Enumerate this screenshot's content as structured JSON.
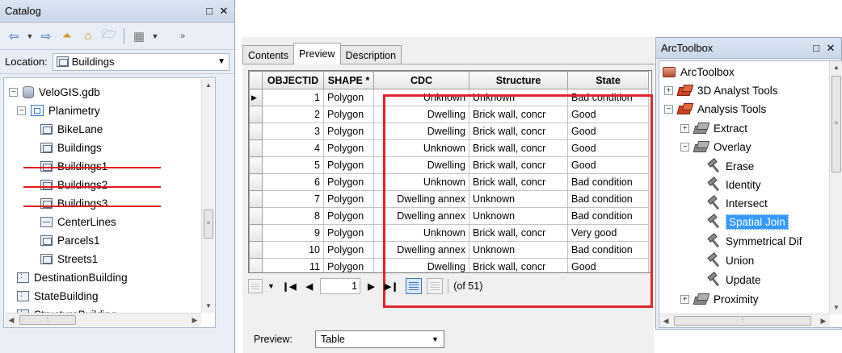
{
  "catalog": {
    "title": "Catalog",
    "location_label": "Location:",
    "location_value": "Buildings",
    "tree": [
      {
        "label": "VeloGIS.gdb",
        "icon": "geodatabase-icon",
        "expander": "−"
      },
      {
        "label": "Planimetry",
        "icon": "feature-dataset-icon",
        "expander": "−"
      },
      {
        "label": "BikeLane",
        "icon": "feature-class-icon"
      },
      {
        "label": "Buildings",
        "icon": "feature-class-icon"
      },
      {
        "label": "Buildings1",
        "icon": "feature-class-icon",
        "struck": true
      },
      {
        "label": "Buildings2",
        "icon": "feature-class-icon",
        "struck": true
      },
      {
        "label": "Buildings3",
        "icon": "feature-class-icon",
        "struck": true
      },
      {
        "label": "CenterLines",
        "icon": "line-feature-class-icon"
      },
      {
        "label": "Parcels1",
        "icon": "feature-class-icon"
      },
      {
        "label": "Streets1",
        "icon": "feature-class-icon"
      },
      {
        "label": "DestinationBuilding",
        "icon": "table-icon"
      },
      {
        "label": "StateBuilding",
        "icon": "table-icon"
      },
      {
        "label": "StructureBuilding",
        "icon": "table-icon"
      }
    ],
    "strike_color": "#e3191f"
  },
  "table_window": {
    "tabs": [
      "Contents",
      "Preview",
      "Description"
    ],
    "active_tab": "Preview",
    "columns": [
      "OBJECTID",
      "SHAPE *",
      "CDC",
      "Structure",
      "State"
    ],
    "rows": [
      [
        "1",
        "Polygon",
        "Unknown",
        "Unknown",
        "Bad condition"
      ],
      [
        "2",
        "Polygon",
        "Dwelling",
        "Brick wall, concr",
        "Good"
      ],
      [
        "3",
        "Polygon",
        "Dwelling",
        "Brick wall, concr",
        "Good"
      ],
      [
        "4",
        "Polygon",
        "Unknown",
        "Brick wall, concr",
        "Good"
      ],
      [
        "5",
        "Polygon",
        "Dwelling",
        "Brick wall, concr",
        "Good"
      ],
      [
        "6",
        "Polygon",
        "Unknown",
        "Brick wall, concr",
        "Bad condition"
      ],
      [
        "7",
        "Polygon",
        "Dwelling annex",
        "Unknown",
        "Bad condition"
      ],
      [
        "8",
        "Polygon",
        "Dwelling annex",
        "Unknown",
        "Bad condition"
      ],
      [
        "9",
        "Polygon",
        "Unknown",
        "Brick wall, concr",
        "Very good"
      ],
      [
        "10",
        "Polygon",
        "Dwelling annex",
        "Unknown",
        "Bad condition"
      ],
      [
        "11",
        "Polygon",
        "Dwelling",
        "Brick wall, concr",
        "Good"
      ]
    ],
    "highlight_color": "#e1252c",
    "nav": {
      "first": "❙◀",
      "prev": "◀",
      "page": "1",
      "next": "▶",
      "last": "▶❙",
      "count": "(of 51)"
    },
    "preview_label": "Preview:",
    "preview_value": "Table"
  },
  "toolbox": {
    "title": "ArcToolbox",
    "tree": [
      {
        "label": "ArcToolbox",
        "icon": "toolbox-icon"
      },
      {
        "label": "3D Analyst Tools",
        "icon": "toolbox-icon",
        "expander": "+"
      },
      {
        "label": "Analysis Tools",
        "icon": "toolbox-icon",
        "expander": "−"
      },
      {
        "label": "Extract",
        "icon": "toolset-icon",
        "expander": "+"
      },
      {
        "label": "Overlay",
        "icon": "toolset-icon",
        "expander": "−"
      },
      {
        "label": "Erase",
        "icon": "tool-icon"
      },
      {
        "label": "Identity",
        "icon": "tool-icon"
      },
      {
        "label": "Intersect",
        "icon": "tool-icon"
      },
      {
        "label": "Spatial Join",
        "icon": "tool-icon",
        "selected": true
      },
      {
        "label": "Symmetrical Dif",
        "icon": "tool-icon"
      },
      {
        "label": "Union",
        "icon": "tool-icon"
      },
      {
        "label": "Update",
        "icon": "tool-icon"
      },
      {
        "label": "Proximity",
        "icon": "toolset-icon",
        "expander": "+"
      }
    ],
    "selection_color": "#3399ff"
  }
}
